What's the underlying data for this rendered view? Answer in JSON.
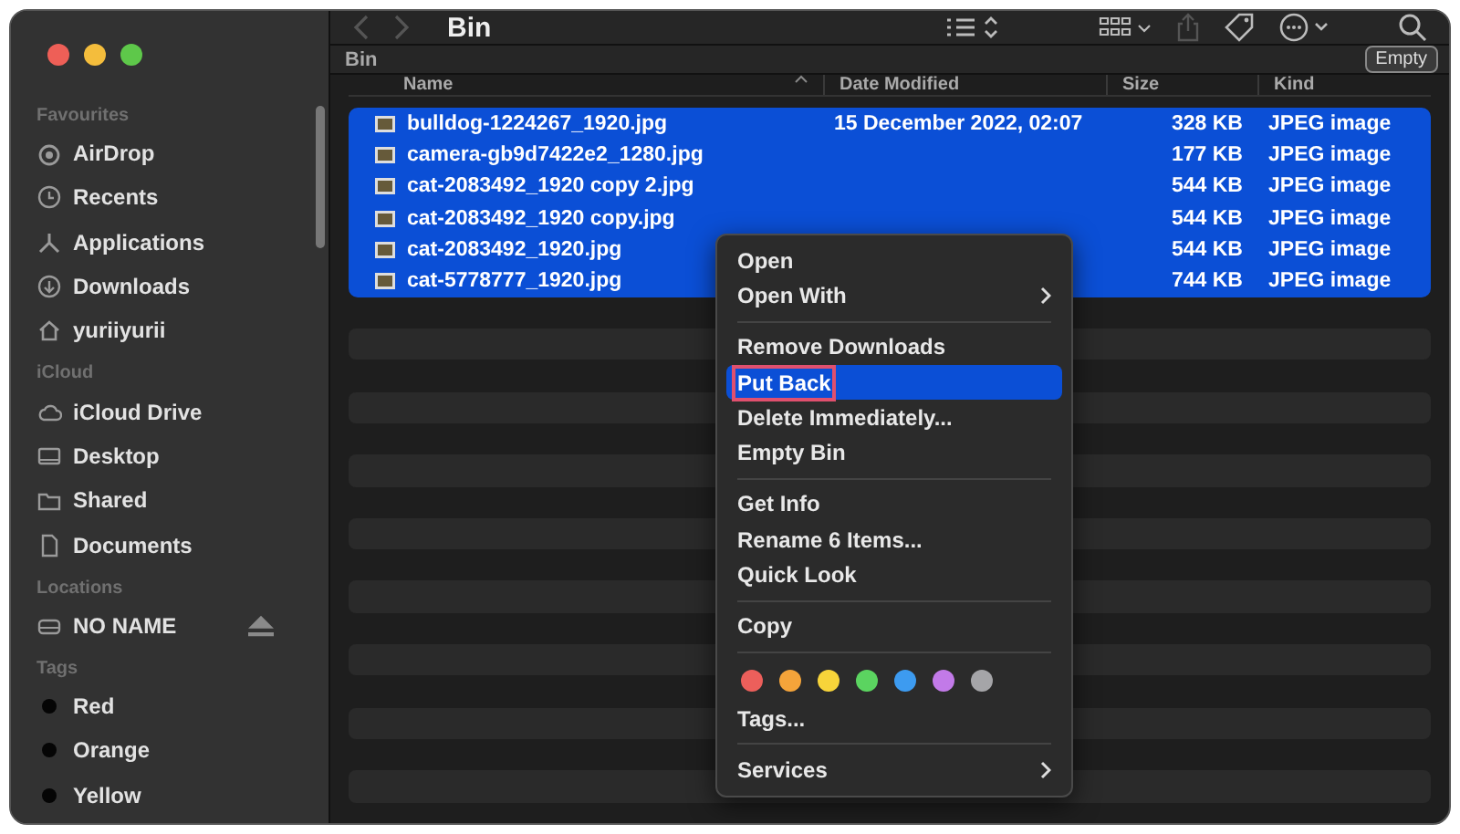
{
  "window": {
    "title": "Bin"
  },
  "sidebar": {
    "sections": [
      {
        "title": "Favourites",
        "items": [
          {
            "label": "AirDrop"
          },
          {
            "label": "Recents"
          },
          {
            "label": "Applications"
          },
          {
            "label": "Downloads"
          },
          {
            "label": "yuriiyurii"
          }
        ]
      },
      {
        "title": "iCloud",
        "items": [
          {
            "label": "iCloud Drive"
          },
          {
            "label": "Desktop"
          },
          {
            "label": "Shared"
          },
          {
            "label": "Documents"
          }
        ]
      },
      {
        "title": "Locations",
        "items": [
          {
            "label": "NO NAME"
          }
        ]
      },
      {
        "title": "Tags",
        "items": [
          {
            "label": "Red"
          },
          {
            "label": "Orange"
          },
          {
            "label": "Yellow"
          }
        ]
      }
    ]
  },
  "path_bar": {
    "label": "Bin",
    "button": "Empty"
  },
  "table": {
    "columns": [
      "Name",
      "Date Modified",
      "Size",
      "Kind"
    ],
    "rows": [
      {
        "name": "bulldog-1224267_1920.jpg",
        "date": "15 December 2022, 02:07",
        "size": "328 KB",
        "kind": "JPEG image",
        "selected": true
      },
      {
        "name": "camera-gb9d7422e2_1280.jpg",
        "size": "177 KB",
        "kind": "JPEG image",
        "selected": true
      },
      {
        "name": "cat-2083492_1920 copy 2.jpg",
        "size": "544 KB",
        "kind": "JPEG image",
        "selected": true
      },
      {
        "name": "cat-2083492_1920 copy.jpg",
        "size": "544 KB",
        "kind": "JPEG image",
        "selected": true
      },
      {
        "name": "cat-2083492_1920.jpg",
        "size": "544 KB",
        "kind": "JPEG image",
        "selected": true
      },
      {
        "name": "cat-5778777_1920.jpg",
        "size": "744 KB",
        "kind": "JPEG image",
        "selected": true
      }
    ]
  },
  "context_menu": {
    "groups": [
      [
        {
          "label": "Open",
          "submenu": false,
          "highlighted": false
        },
        {
          "label": "Open With",
          "submenu": true,
          "highlighted": false
        }
      ],
      [
        {
          "label": "Remove Downloads",
          "submenu": false,
          "highlighted": false
        },
        {
          "label": "Put Back",
          "submenu": false,
          "highlighted": true
        },
        {
          "label": "Delete Immediately...",
          "submenu": false,
          "highlighted": false
        },
        {
          "label": "Empty Bin",
          "submenu": false,
          "highlighted": false
        }
      ],
      [
        {
          "label": "Get Info",
          "submenu": false,
          "highlighted": false
        },
        {
          "label": "Rename 6 Items...",
          "submenu": false,
          "highlighted": false
        },
        {
          "label": "Quick Look",
          "submenu": false,
          "highlighted": false
        }
      ],
      [
        {
          "label": "Copy",
          "submenu": false,
          "highlighted": false
        }
      ],
      [
        {
          "label": "Tags...",
          "submenu": false,
          "highlighted": false
        }
      ],
      [
        {
          "label": "Services",
          "submenu": true,
          "highlighted": false
        }
      ]
    ]
  }
}
